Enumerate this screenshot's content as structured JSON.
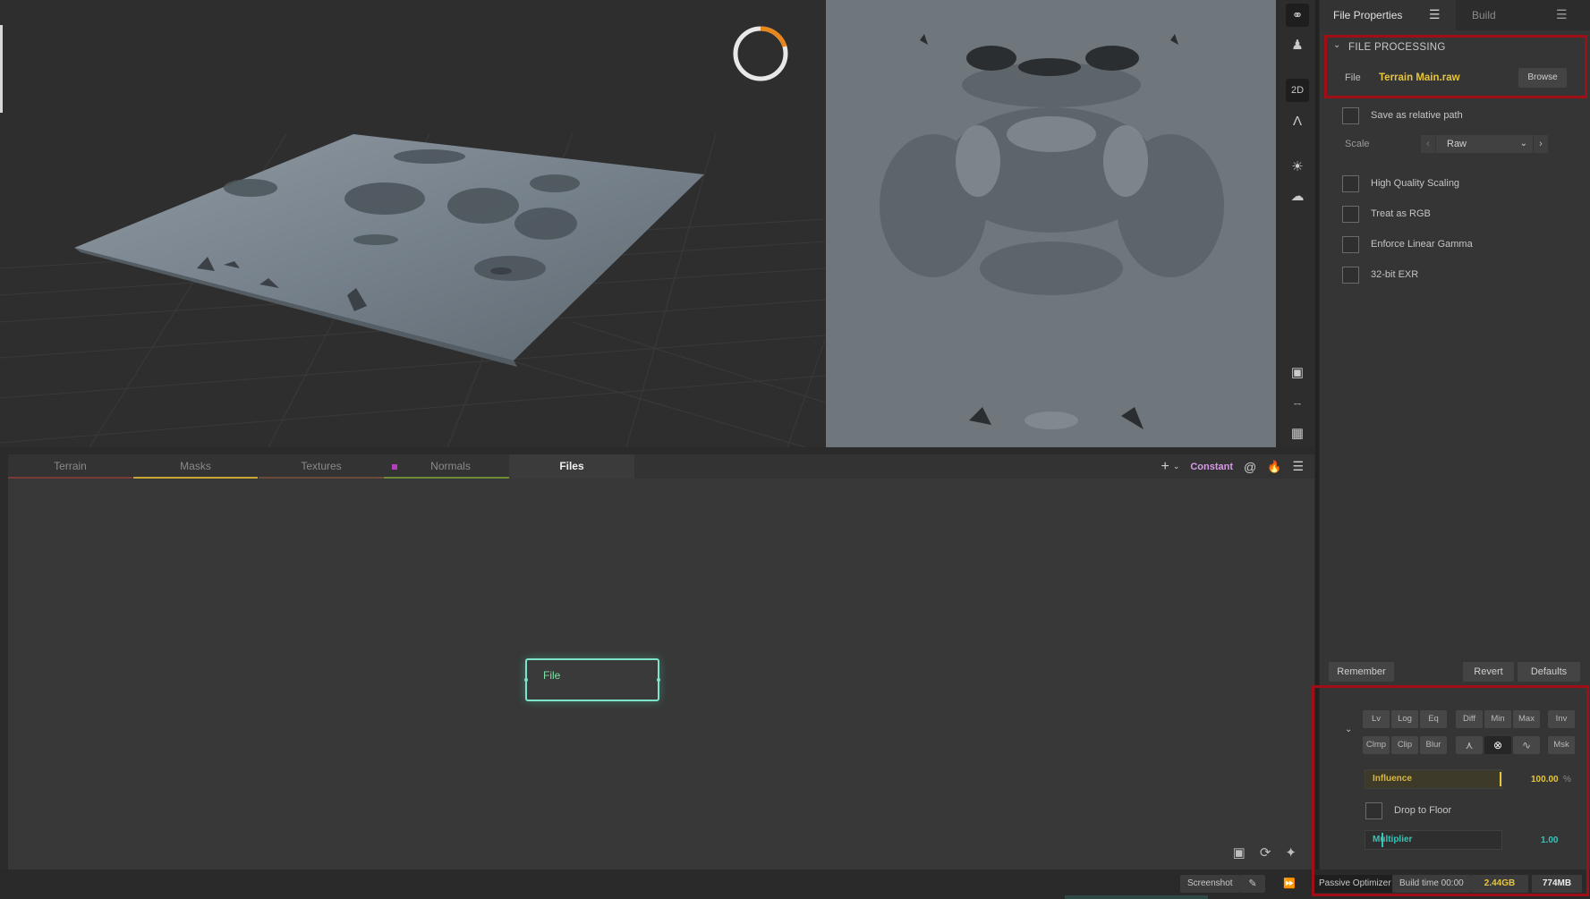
{
  "viewport_2d": {
    "label": "2D"
  },
  "graph": {
    "tabs": [
      {
        "label": "Terrain",
        "color": "#b5453f"
      },
      {
        "label": "Masks",
        "color": "#c9a532"
      },
      {
        "label": "Textures",
        "color": "#7a5a3a"
      },
      {
        "label": "Normals",
        "color": "#7a9a3a"
      },
      {
        "label": "Files",
        "color": "#3b3b3b"
      }
    ],
    "toolbar": {
      "add": "+",
      "mode": "Constant"
    },
    "node": {
      "label": "File"
    }
  },
  "right_panel": {
    "tab_properties": "File Properties",
    "tab_build": "Build",
    "section": "FILE PROCESSING",
    "file_label": "File",
    "file_value": "Terrain Main.raw",
    "browse": "Browse",
    "save_relative": "Save as relative path",
    "scale_label": "Scale",
    "scale_value": "Raw",
    "options": [
      "High Quality Scaling",
      "Treat as RGB",
      "Enforce Linear Gamma",
      "32-bit EXR"
    ],
    "remember": "Remember",
    "revert": "Revert",
    "defaults": "Defaults",
    "modifiers_row1": [
      "Lv",
      "Log",
      "Eq",
      "Diff",
      "Min",
      "Max",
      "Inv"
    ],
    "modifiers_row2": [
      "Clmp",
      "Clip",
      "Blur",
      "Msk"
    ],
    "influence_label": "Influence",
    "influence_value": "100.00",
    "influence_unit": "%",
    "drop_to_floor": "Drop to Floor",
    "multiplier_label": "Multiplier",
    "multiplier_value": "1.00"
  },
  "statusbar": {
    "screenshot": "Screenshot",
    "optimizer": "Passive Optimizer",
    "build_time": "Build time 00:00",
    "memory": "2.44GB",
    "vram": "774MB"
  },
  "colors": {
    "accent_yellow": "#e7c53a",
    "accent_teal": "#35c4b8",
    "frame_red": "#a10f16",
    "node_green": "#7fe3c9"
  }
}
